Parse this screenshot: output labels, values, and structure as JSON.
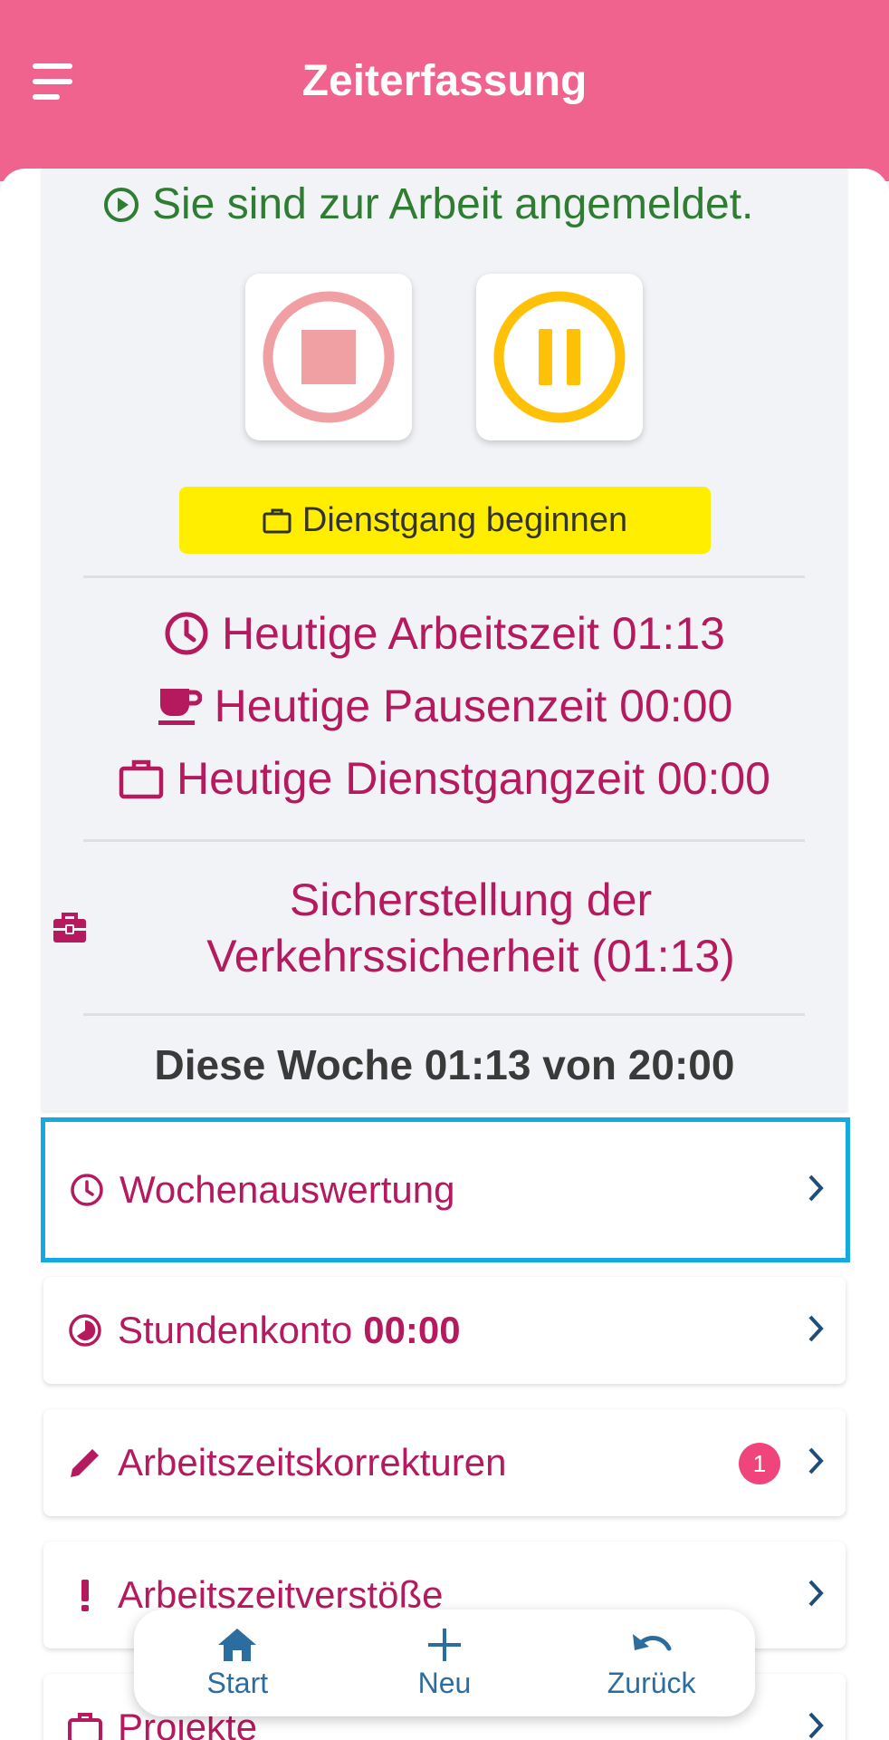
{
  "app": {
    "title": "Zeiterfassung"
  },
  "status": {
    "signed_in_text": "Sie sind zur Arbeit angemeldet.",
    "errand_button_label": "Dienstgang beginnen",
    "stats": {
      "work_time": "Heutige Arbeitszeit 01:13",
      "break_time": "Heutige Pausenzeit 00:00",
      "errand_time": "Heutige Dienstgangzeit 00:00"
    },
    "project": "Sicherstellung der Verkehrssicherheit (01:13)",
    "week_summary": "Diese Woche 01:13 von 20:00"
  },
  "menu": {
    "items": [
      {
        "label": "Wochenauswertung",
        "icon": "clock-icon"
      },
      {
        "label": "Stundenkonto",
        "value": "00:00",
        "icon": "pie-icon"
      },
      {
        "label": "Arbeitszeitskorrekturen",
        "badge": "1",
        "icon": "pencil-icon"
      },
      {
        "label": "Arbeitszeitverstöße",
        "icon": "exclamation-icon"
      },
      {
        "label": "Projekte",
        "icon": "briefcase-icon"
      }
    ]
  },
  "bottom_nav": {
    "start": "Start",
    "new": "Neu",
    "back": "Zurück"
  },
  "colors": {
    "header": "#f0638e",
    "accent": "#b5195e",
    "success": "#2e7d32",
    "stop": "#f0a0a3",
    "pause": "#ffc107",
    "errand_button": "#ffee00",
    "nav": "#2c6da0",
    "selection": "#14a9e1"
  }
}
